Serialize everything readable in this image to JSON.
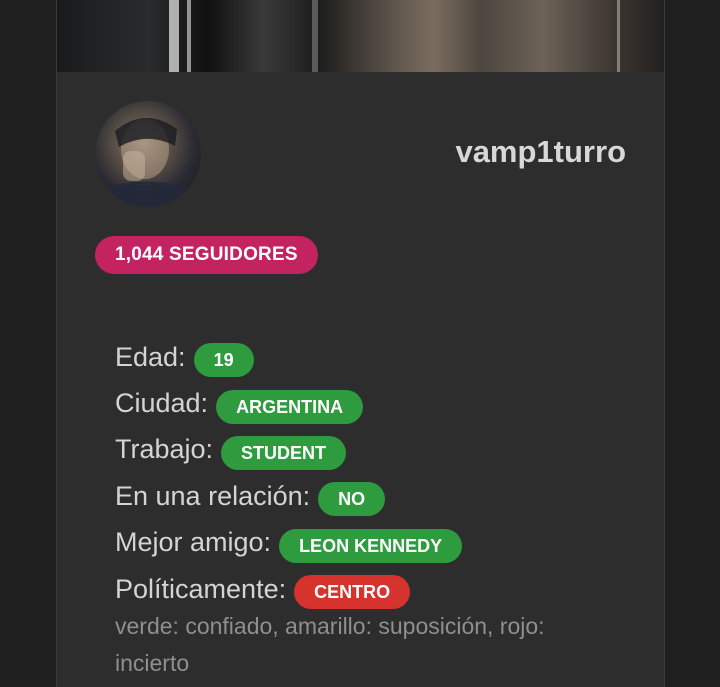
{
  "profile": {
    "username": "vamp1turro",
    "followers_label": "1,044 SEGUIDORES"
  },
  "colors": {
    "card_bg": "#2d2d2d",
    "followers_badge": "#c42361",
    "green": "#2e9b3f",
    "red": "#d6322e"
  },
  "fields": [
    {
      "label": "Edad:",
      "value": "19",
      "status": "green"
    },
    {
      "label": "Ciudad:",
      "value": "ARGENTINA",
      "status": "green"
    },
    {
      "label": "Trabajo:",
      "value": "STUDENT",
      "status": "green"
    },
    {
      "label": "En una relación:",
      "value": "NO",
      "status": "green"
    },
    {
      "label": "Mejor amigo:",
      "value": "LEON KENNEDY",
      "status": "green"
    },
    {
      "label": "Políticamente:",
      "value": "CENTRO",
      "status": "red"
    }
  ],
  "legend": "verde: confiado, amarillo: suposición, rojo: incierto"
}
